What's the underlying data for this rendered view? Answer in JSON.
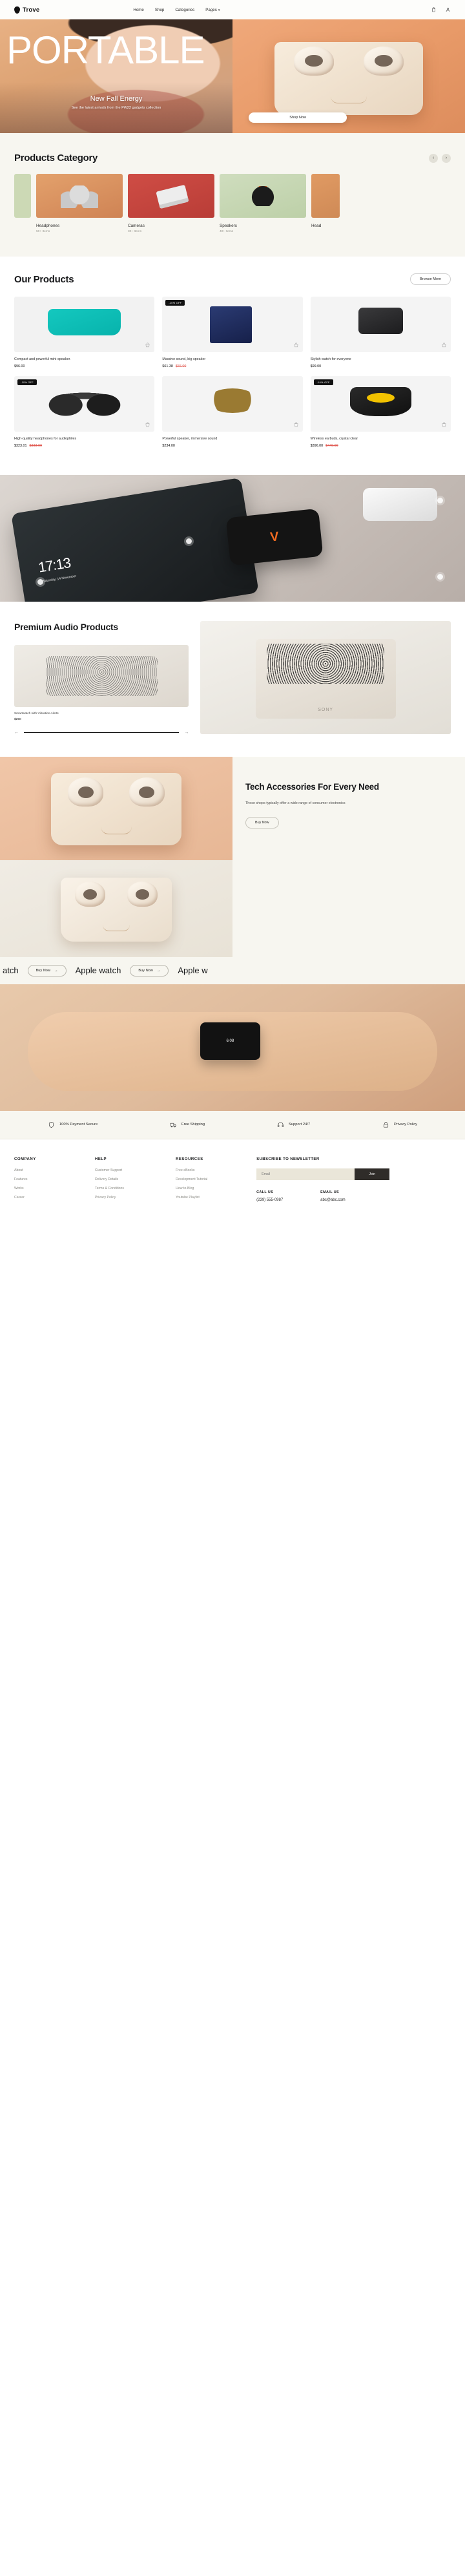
{
  "header": {
    "brand": "Trove",
    "nav": [
      {
        "label": "Home",
        "caret": false
      },
      {
        "label": "Shop",
        "caret": false
      },
      {
        "label": "Categories",
        "caret": false
      },
      {
        "label": "Pages",
        "caret": true
      }
    ],
    "caret_glyph": "▾",
    "icons": [
      "bag-icon",
      "user-icon"
    ]
  },
  "hero": {
    "title": "PORTABLE",
    "heading": "New Fall Energy",
    "subtitle": "See the latest arrivals from the FW22 gadgets collection",
    "cta": "Shop Now"
  },
  "categories": {
    "title": "Products Category",
    "prev": "‹",
    "next": "›",
    "items": [
      {
        "label": "Headphones",
        "count": "50+ Items"
      },
      {
        "label": "Cameras",
        "count": "30+ Items"
      },
      {
        "label": "Speakers",
        "count": "40+ Items"
      },
      {
        "label": "Head",
        "count": ""
      }
    ]
  },
  "products": {
    "title": "Our Products",
    "browse": "Browse More",
    "items": [
      {
        "name": "Compact and powerful mini-speaker.",
        "price": "$96.00",
        "old_price": "",
        "badge": ""
      },
      {
        "name": "Massive sound, big speaker",
        "price": "$61.38",
        "old_price": "$66.00",
        "badge": "-10% OFF"
      },
      {
        "name": "Stylish watch for everyone",
        "price": "$99.00",
        "old_price": "",
        "badge": ""
      },
      {
        "name": "High-quality headphones for audiophiles",
        "price": "$323.01",
        "old_price": "$333.00",
        "badge": "-10% OFF"
      },
      {
        "name": "Powerful speaker, immersive sound",
        "price": "$234.00",
        "old_price": "",
        "badge": ""
      },
      {
        "name": "Wireless earbuds, crystal clear",
        "price": "$396.00",
        "old_price": "$440.00",
        "badge": "-10% OFF"
      }
    ]
  },
  "lifestyle": {
    "phone_time": "17:13",
    "phone_date": "Saturday, 14 November"
  },
  "premium": {
    "title": "Premium Audio Products",
    "caption": "Smartwatch with Vibration Alerts",
    "price": "$250",
    "prev": "←",
    "next": "→",
    "speaker_brand": "SONY"
  },
  "tech": {
    "title": "Tech Accessories For Every Need",
    "subtitle": "These shops typically offer a wide range of consumer electronics",
    "cta": "Buy Now"
  },
  "marquee": {
    "segments": [
      {
        "type": "text",
        "value": "atch"
      },
      {
        "type": "button",
        "value": "Buy Now"
      },
      {
        "type": "text",
        "value": "Apple watch"
      },
      {
        "type": "button",
        "value": "Buy Now"
      },
      {
        "type": "text",
        "value": "Apple w"
      }
    ],
    "arrow": "→"
  },
  "wrist": {
    "time": "6:08"
  },
  "features": [
    {
      "label": "100% Payment Secure",
      "icon": "shield-icon"
    },
    {
      "label": "Free Shipping",
      "icon": "truck-icon"
    },
    {
      "label": "Support 24/7",
      "icon": "headset-icon"
    },
    {
      "label": "Privacy Policy",
      "icon": "lock-icon"
    }
  ],
  "footer": {
    "columns": [
      {
        "heading": "COMPANY",
        "links": [
          "About",
          "Features",
          "Works",
          "Career"
        ]
      },
      {
        "heading": "HELP",
        "links": [
          "Customer Support",
          "Delivery Details",
          "Terms & Conditions",
          "Privacy Policy"
        ]
      },
      {
        "heading": "RESOURCES",
        "links": [
          "Free eBooks",
          "Development Tutorial",
          "How to-Blog",
          "Youtube Playlist"
        ]
      }
    ],
    "newsletter": {
      "heading": "SUBSCRIBE TO NEWSLETTER",
      "placeholder": "Email",
      "value": "",
      "button": "Join"
    },
    "contact": {
      "call_label": "CALL US",
      "call_value": "(239) 555-0987",
      "email_label": "EMAIL US",
      "email_value": "abc@abc.com"
    }
  }
}
